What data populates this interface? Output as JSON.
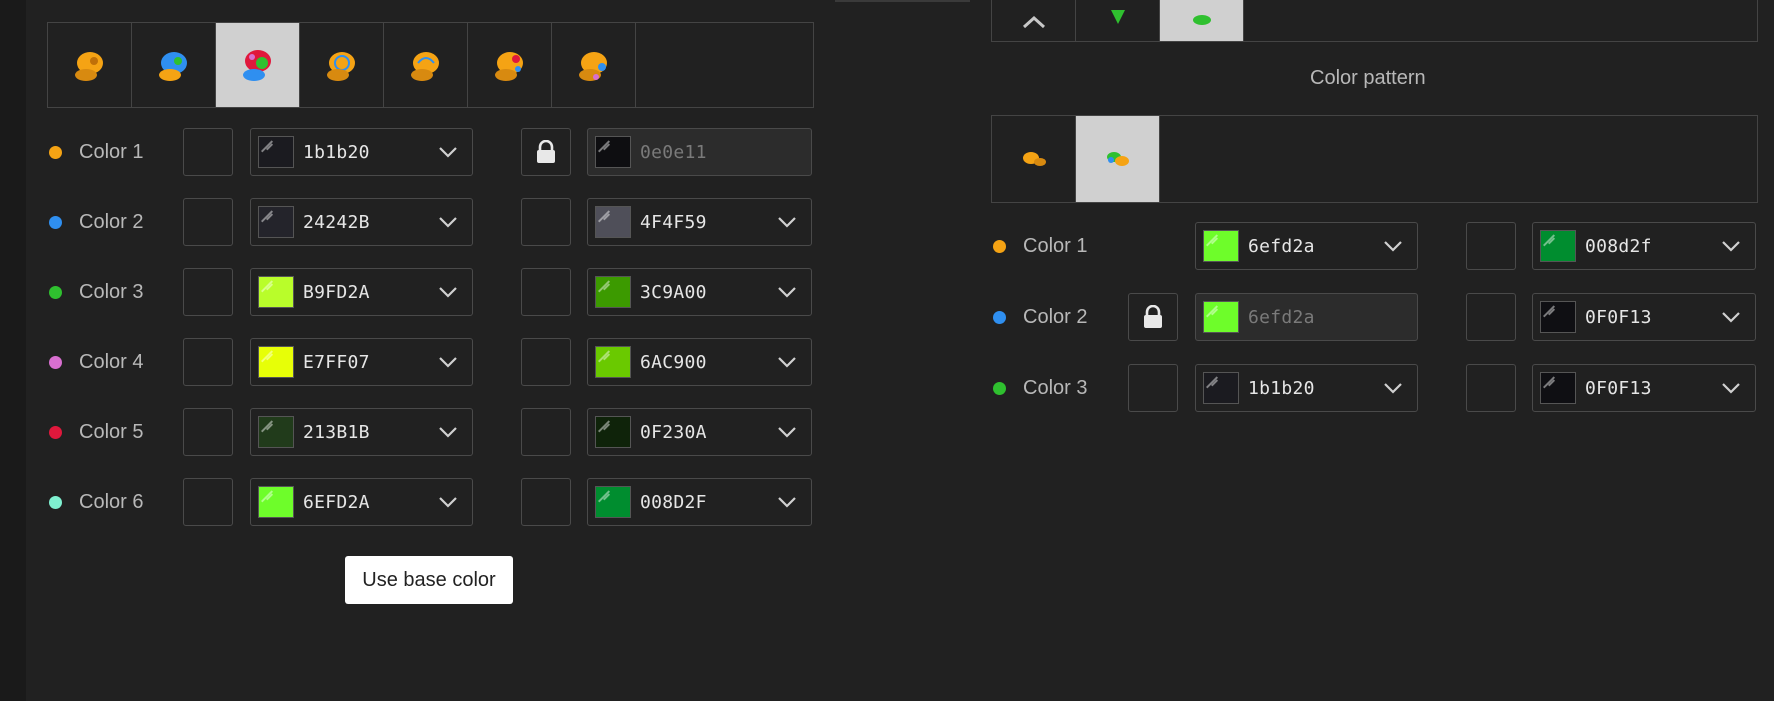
{
  "left_panel": {
    "variant_tabs": [
      "variant-1",
      "variant-2",
      "variant-3",
      "variant-4",
      "variant-5",
      "variant-6",
      "variant-7"
    ],
    "selected_tab": 2,
    "rows": [
      {
        "label": "Color 1",
        "dot": "#f5a314",
        "base_value": "1b1b20",
        "base_swatch": "#1b1b20",
        "base_locked": false,
        "shiny_value": "0e0e11",
        "shiny_swatch": "#0e0e11",
        "shiny_locked": true
      },
      {
        "label": "Color 2",
        "dot": "#2f8ff0",
        "base_value": "24242B",
        "base_swatch": "#24242b",
        "base_locked": false,
        "shiny_value": "4F4F59",
        "shiny_swatch": "#4f4f59",
        "shiny_locked": false
      },
      {
        "label": "Color 3",
        "dot": "#2fc02f",
        "base_value": "B9FD2A",
        "base_swatch": "#b9fd2a",
        "base_locked": false,
        "shiny_value": "3C9A00",
        "shiny_swatch": "#3c9a00",
        "shiny_locked": false
      },
      {
        "label": "Color 4",
        "dot": "#d86fd0",
        "base_value": "E7FF07",
        "base_swatch": "#e7ff07",
        "base_locked": false,
        "shiny_value": "6AC900",
        "shiny_swatch": "#6ac900",
        "shiny_locked": false
      },
      {
        "label": "Color 5",
        "dot": "#e0183c",
        "base_value": "213B1B",
        "base_swatch": "#213b1b",
        "base_locked": false,
        "shiny_value": "0F230A",
        "shiny_swatch": "#0f230a",
        "shiny_locked": false
      },
      {
        "label": "Color 6",
        "dot": "#7ff0d0",
        "base_value": "6EFD2A",
        "base_swatch": "#6efd2a",
        "base_locked": false,
        "shiny_value": "008D2F",
        "shiny_swatch": "#008d2f",
        "shiny_locked": false
      }
    ],
    "tooltip": "Use base color"
  },
  "right_panel": {
    "section_title": "Color pattern",
    "pattern_tabs": [
      "pattern-1",
      "pattern-2"
    ],
    "selected_pattern": 1,
    "rows": [
      {
        "label": "Color 1",
        "dot": "#f5a314",
        "base_value": "6efd2a",
        "base_swatch": "#6efd2a",
        "base_locked": false,
        "base_lock_visible": false,
        "shiny_value": "008d2f",
        "shiny_swatch": "#008d2f"
      },
      {
        "label": "Color 2",
        "dot": "#2f8ff0",
        "base_value": "6efd2a",
        "base_swatch": "#6efd2a",
        "base_locked": true,
        "base_lock_visible": true,
        "shiny_value": "0F0F13",
        "shiny_swatch": "#0f0f13"
      },
      {
        "label": "Color 3",
        "dot": "#2fc02f",
        "base_value": "1b1b20",
        "base_swatch": "#1b1b20",
        "base_locked": false,
        "base_lock_visible": true,
        "shiny_value": "0F0F13",
        "shiny_swatch": "#0f0f13"
      }
    ]
  }
}
